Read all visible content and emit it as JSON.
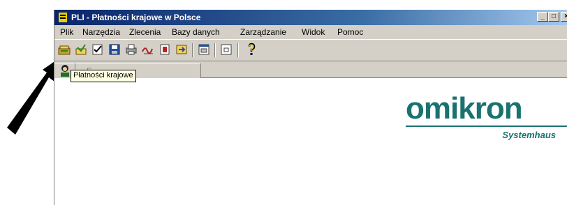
{
  "window": {
    "title": "PLI - Płatności krajowe w Polsce",
    "controls": {
      "minimize": "_",
      "maximize": "□",
      "close": "×"
    }
  },
  "menu": [
    {
      "label": "Plik"
    },
    {
      "label": "Narzędzia"
    },
    {
      "label": "Zlecenia"
    },
    {
      "label": "Bazy danych"
    },
    {
      "label": "Zarządzanie"
    },
    {
      "label": "Widok"
    },
    {
      "label": "Pomoc"
    }
  ],
  "toolbar": {
    "icons": [
      "platnosci-krajowe-icon",
      "edit-order-icon",
      "check-icon",
      "save-icon",
      "print-icon",
      "signature-icon",
      "export-icon",
      "transfer-icon",
      "window-icon",
      "list-icon",
      "help-icon"
    ]
  },
  "tabs": [
    {
      "label": "F"
    }
  ],
  "tooltip": {
    "text": "Płatności krajowe"
  },
  "logo": {
    "main": "omikron",
    "sub": "Systemhaus"
  },
  "colors": {
    "brand": "#1a7270",
    "titlebar": "#0a246a",
    "face": "#d4d0c8",
    "tooltip": "#ffffe1"
  }
}
